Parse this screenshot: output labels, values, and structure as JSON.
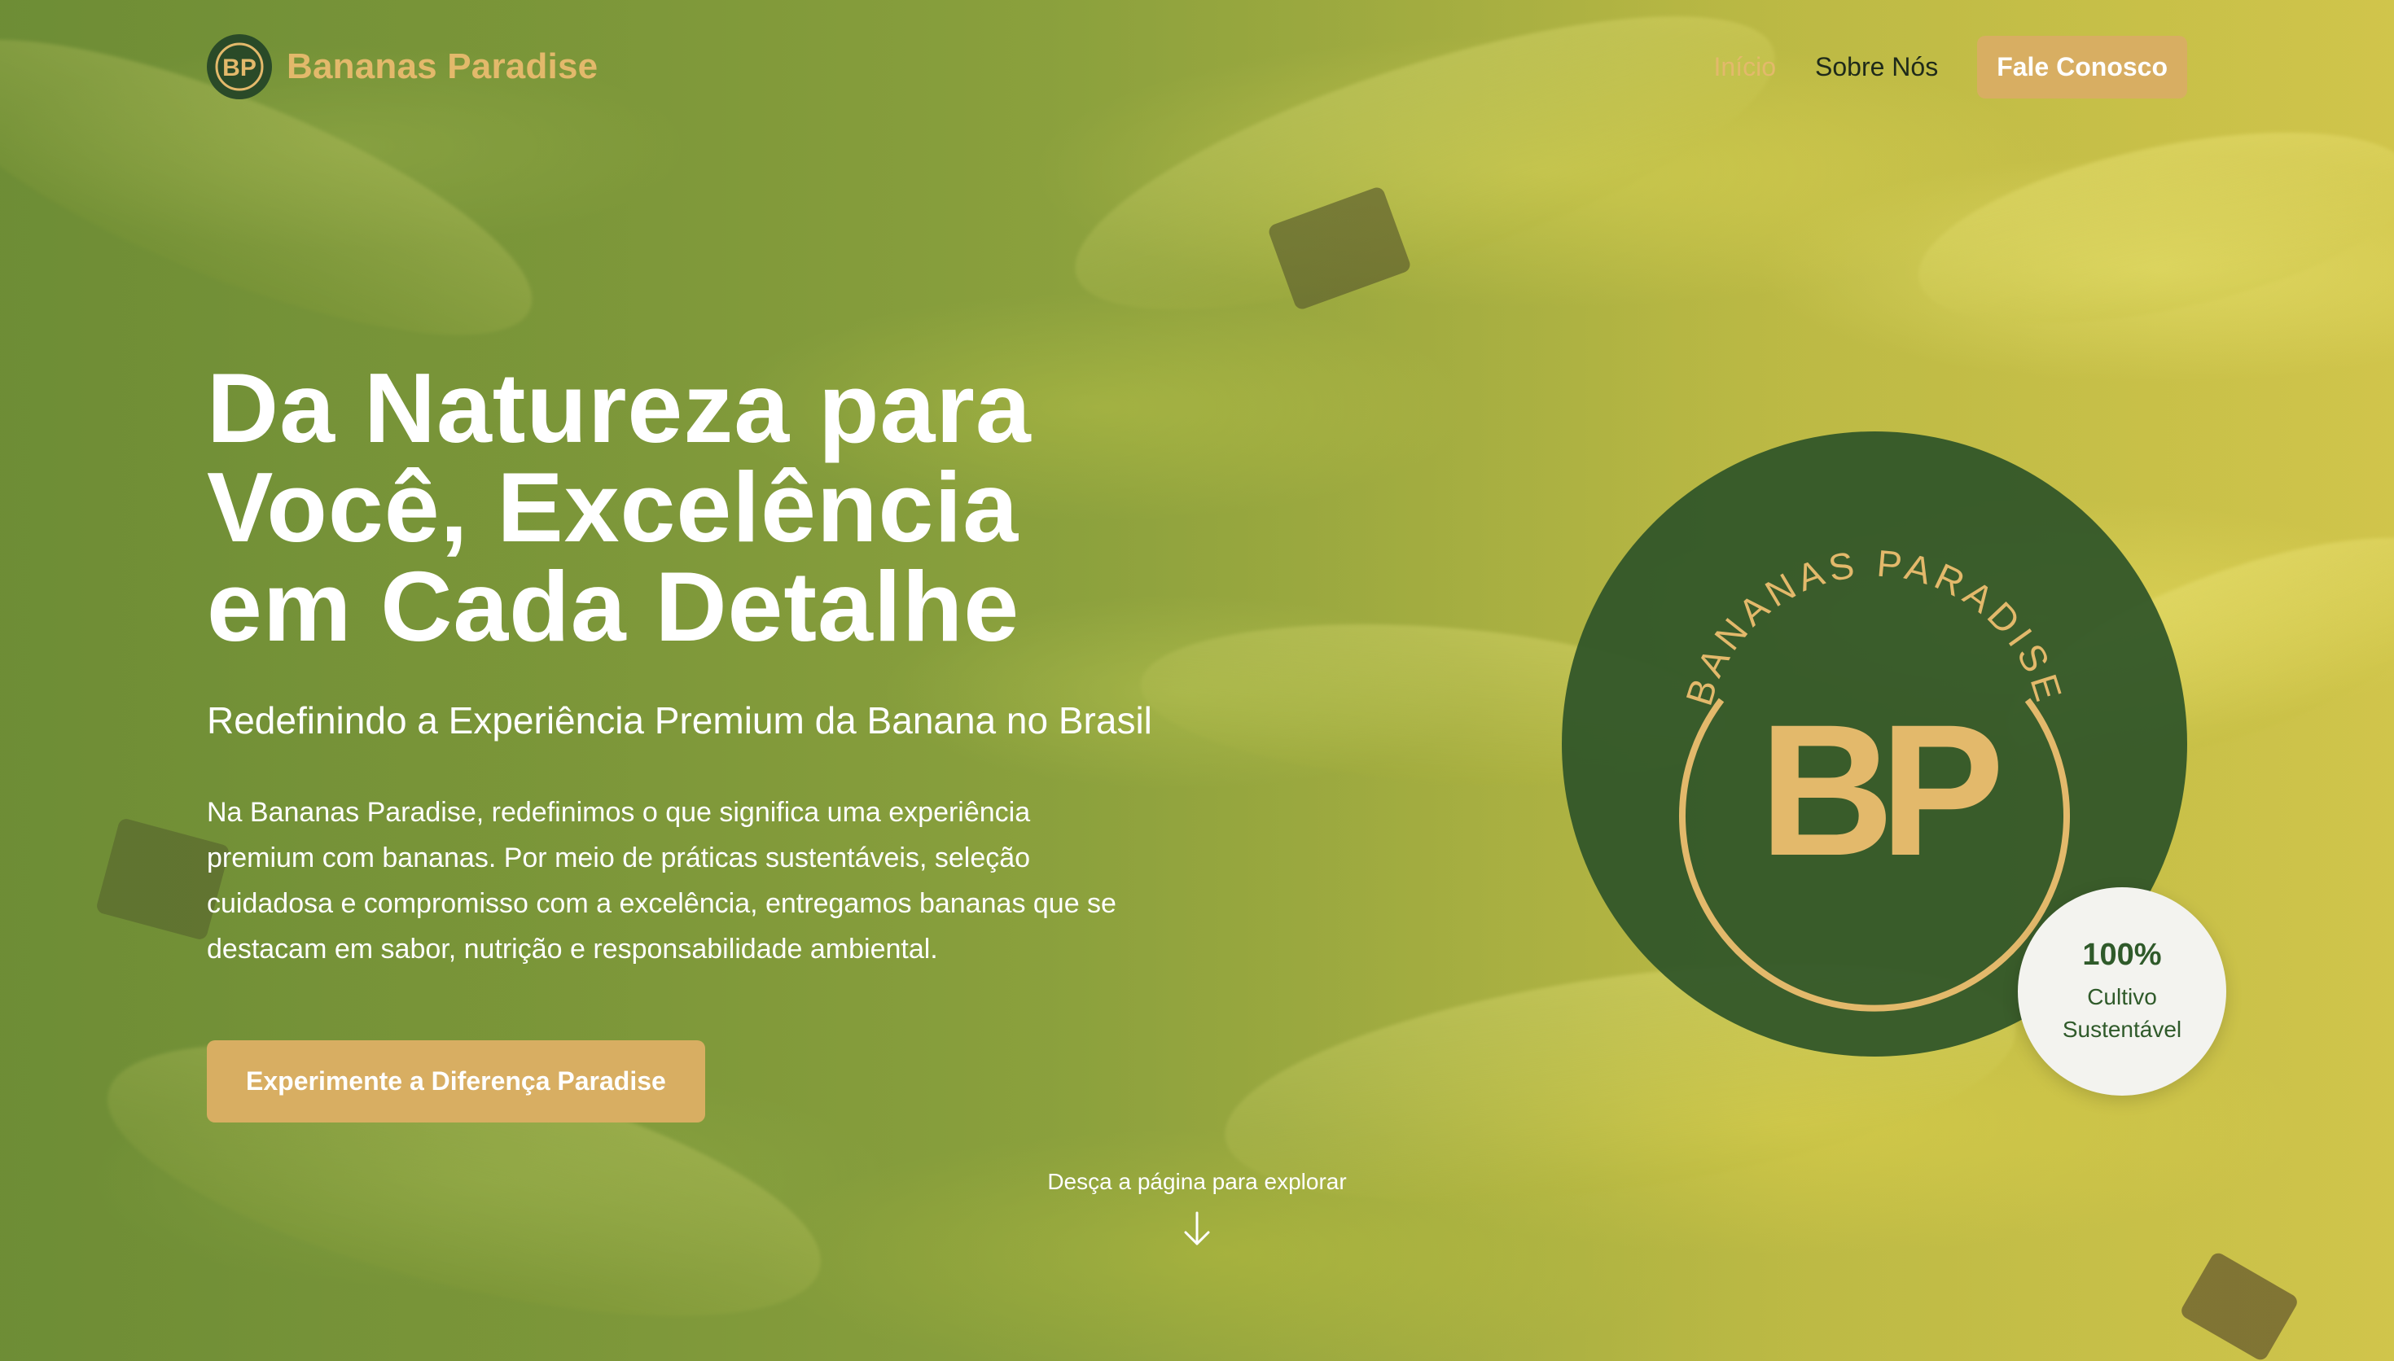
{
  "brand": {
    "name": "Bananas Paradise",
    "logo_initials": "BP"
  },
  "nav": {
    "items": [
      {
        "label": "Início",
        "active": true
      },
      {
        "label": "Sobre Nós",
        "active": false
      }
    ],
    "cta_label": "Fale Conosco"
  },
  "hero": {
    "title_lines": [
      "Da Natureza para",
      "Você, Excelência",
      "em Cada Detalhe"
    ],
    "subtitle": "Redefinindo a Experiência Premium da Banana no Brasil",
    "body": "Na Bananas Paradise, redefinimos o que significa uma experiência premium com bananas. Por meio de práticas sustentáveis, seleção cuidadosa e compromisso com a excelência, entregamos bananas que se destacam em sabor, nutrição e responsabilidade ambiental.",
    "cta_label": "Experimente a Diferença Paradise"
  },
  "badge": {
    "ring_text": "BANANAS PARADISE",
    "initials": "BP"
  },
  "stat": {
    "value": "100%",
    "label_line1": "Cultivo",
    "label_line2": "Sustentável"
  },
  "scroll_hint": {
    "text": "Desça a página para explorar",
    "icon": "arrow-down-icon"
  },
  "colors": {
    "accent_gold": "#d8ae62",
    "brand_text": "#e3b96b",
    "dark_green": "#2a4a28",
    "stat_green": "#2f5a2a",
    "nav_text": "#1f2a1a"
  }
}
